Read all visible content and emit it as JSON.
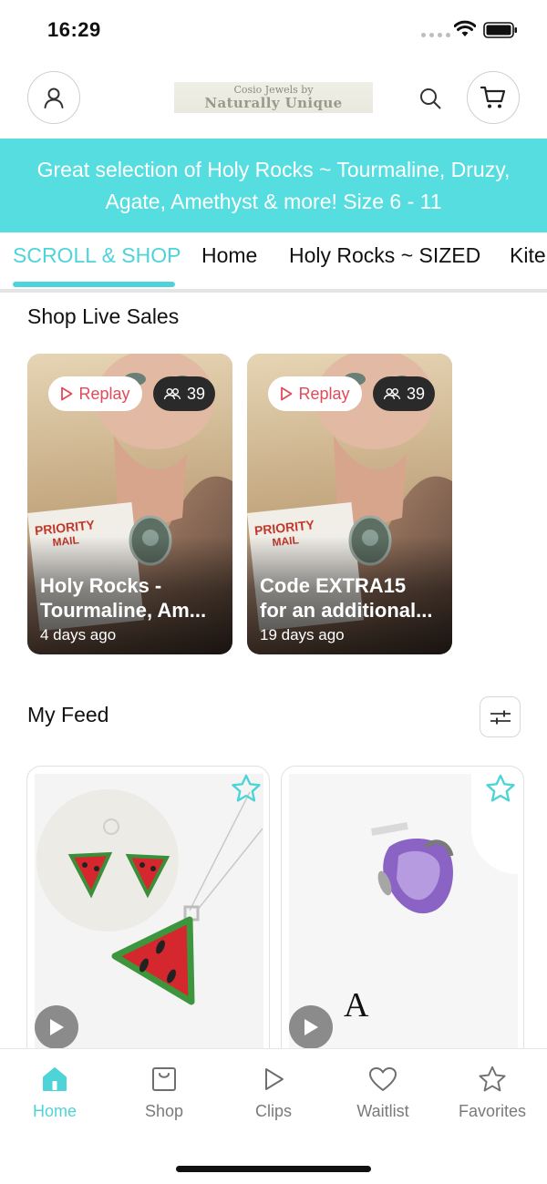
{
  "status_bar": {
    "time": "16:29"
  },
  "header": {
    "logo_line1": "Cosio Jewels by",
    "logo_line2": "Naturally Unique",
    "icons": {
      "account": "person-icon",
      "search": "search-icon",
      "cart": "cart-icon"
    }
  },
  "banner": {
    "text": "Great selection of Holy Rocks ~  Tourmaline, Druzy, Agate, Amethyst & more! Size 6  - 11"
  },
  "tabs": [
    {
      "label": "SCROLL & SHOP",
      "active": true
    },
    {
      "label": "Home",
      "active": false
    },
    {
      "label": "Holy Rocks ~ SIZED",
      "active": false
    },
    {
      "label": "Kite",
      "active": false
    }
  ],
  "live_section": {
    "title": "Shop Live Sales",
    "cards": [
      {
        "badge": "Replay",
        "viewers": "39",
        "title_line1": "Holy Rocks -",
        "title_line2": "Tourmaline, Am...",
        "time": "4 days ago"
      },
      {
        "badge": "Replay",
        "viewers": "39",
        "title_line1": "Code EXTRA15",
        "title_line2": "for an additional...",
        "time": "19 days ago"
      }
    ]
  },
  "feed_section": {
    "title": "My Feed",
    "filter_icon": "sliders-icon"
  },
  "bottom_nav": [
    {
      "label": "Home",
      "icon": "home-icon",
      "active": true
    },
    {
      "label": "Shop",
      "icon": "shopping-bag-icon",
      "active": false
    },
    {
      "label": "Clips",
      "icon": "play-icon",
      "active": false
    },
    {
      "label": "Waitlist",
      "icon": "heart-icon",
      "active": false
    },
    {
      "label": "Favorites",
      "icon": "star-icon",
      "active": false
    }
  ],
  "colors": {
    "accent": "#4ed4d8",
    "banner": "#55dde0",
    "replay": "#e14a5a"
  }
}
